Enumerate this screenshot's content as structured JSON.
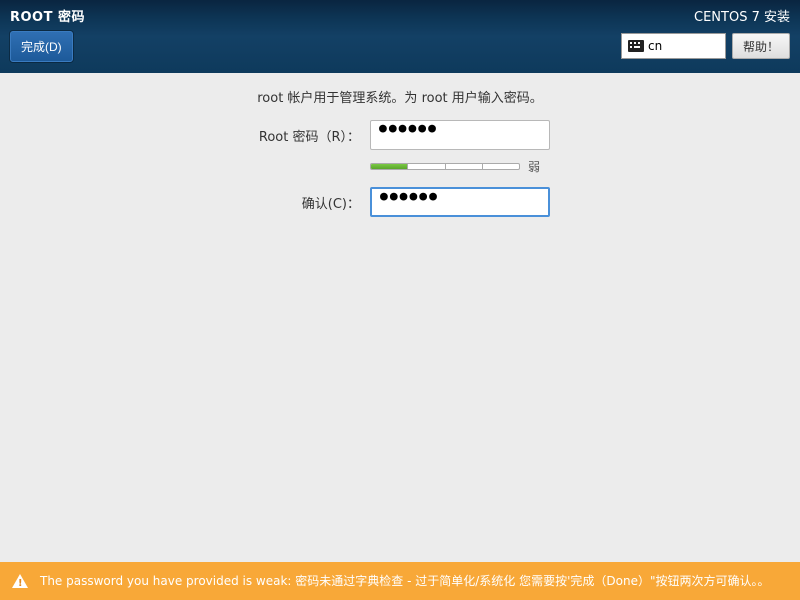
{
  "header": {
    "title": "ROOT 密码",
    "done_label": "完成(D)",
    "install_title": "CENTOS 7 安装",
    "lang_code": "cn",
    "help_label": "帮助！"
  },
  "form": {
    "instruction": "root 帐户用于管理系统。为 root 用户输入密码。",
    "password_label": "Root 密码（R）：",
    "confirm_label": "确认(C)：",
    "password_value": "●●●●●●",
    "confirm_value": "●●●●●●",
    "strength_label": "弱",
    "strength_filled_segments": 1,
    "strength_total_segments": 4
  },
  "warning": {
    "message": "The password you have provided is weak: 密码未通过字典检查 - 过于简单化/系统化 您需要按'完成（Done）\"按钮两次方可确认。。"
  }
}
